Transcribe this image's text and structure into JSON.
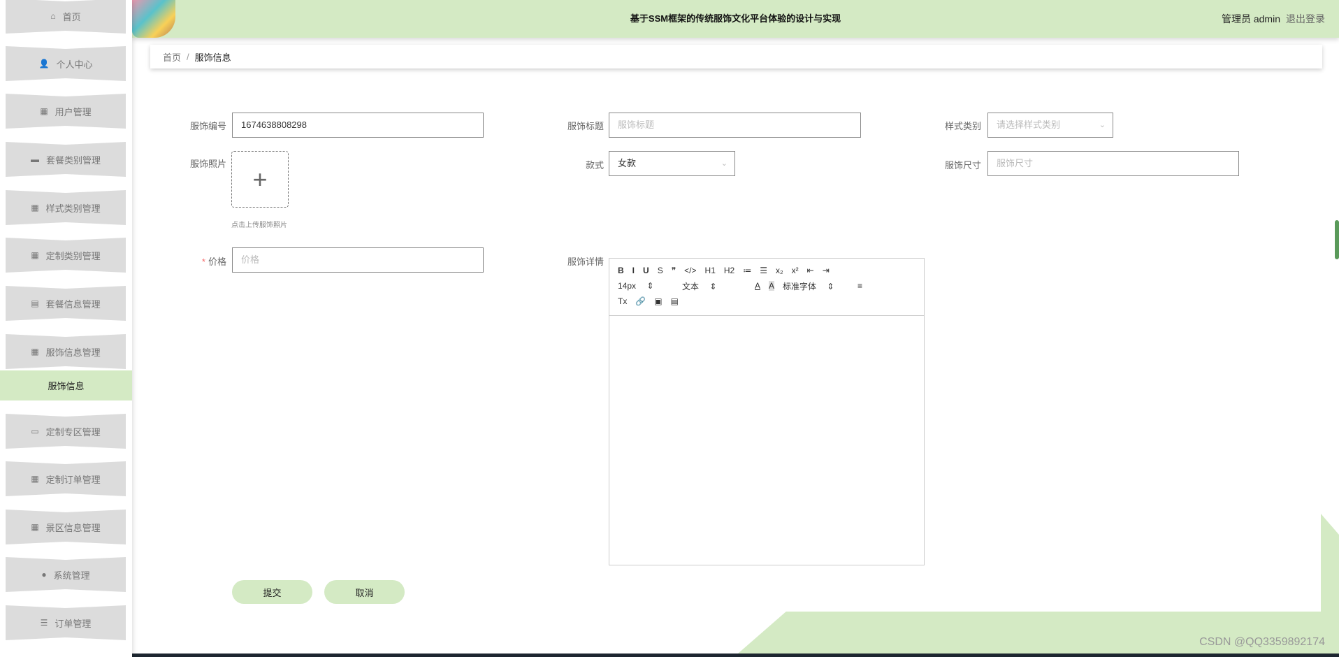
{
  "header": {
    "title": "基于SSM框架的传统服饰文化平台体验的设计与实现",
    "role": "管理员 admin",
    "logout": "退出登录"
  },
  "sidebar": {
    "items": [
      {
        "label": "首页",
        "icon": "home-icon",
        "glyph": "⌂"
      },
      {
        "label": "个人中心",
        "icon": "user-icon",
        "glyph": "👤"
      },
      {
        "label": "用户管理",
        "icon": "grid-icon",
        "glyph": "▦"
      },
      {
        "label": "套餐类别管理",
        "icon": "briefcase-icon",
        "glyph": "▬"
      },
      {
        "label": "样式类别管理",
        "icon": "grid-icon",
        "glyph": "▦"
      },
      {
        "label": "定制类别管理",
        "icon": "grid-icon",
        "glyph": "▦"
      },
      {
        "label": "套餐信息管理",
        "icon": "clipboard-icon",
        "glyph": "▤"
      },
      {
        "label": "服饰信息管理",
        "icon": "grid-icon",
        "glyph": "▦"
      },
      {
        "label": "定制专区管理",
        "icon": "monitor-icon",
        "glyph": "▭"
      },
      {
        "label": "定制订单管理",
        "icon": "grid-icon",
        "glyph": "▦"
      },
      {
        "label": "景区信息管理",
        "icon": "grid-icon",
        "glyph": "▦"
      },
      {
        "label": "系统管理",
        "icon": "location-icon",
        "glyph": "●"
      },
      {
        "label": "订单管理",
        "icon": "list-icon",
        "glyph": "☰"
      }
    ],
    "active_sub": "服饰信息"
  },
  "breadcrumb": {
    "home": "首页",
    "sep": "/",
    "current": "服饰信息"
  },
  "form": {
    "code_label": "服饰编号",
    "code_value": "1674638808298",
    "title_label": "服饰标题",
    "title_placeholder": "服饰标题",
    "style_label": "样式类别",
    "style_placeholder": "请选择样式类别",
    "photo_label": "服饰照片",
    "photo_hint": "点击上传服饰照片",
    "type_label": "款式",
    "type_value": "女款",
    "size_label": "服饰尺寸",
    "size_placeholder": "服饰尺寸",
    "price_label": "价格",
    "price_placeholder": "价格",
    "detail_label": "服饰详情"
  },
  "editor": {
    "row1": [
      "B",
      "I",
      "U",
      "S",
      "❞",
      "</>",
      "H1",
      "H2",
      "≔",
      "☰",
      "x₂",
      "x²",
      "⇤",
      "⇥"
    ],
    "font_size": "14px",
    "header": "文本",
    "font_color": "A",
    "bg_color": "A",
    "font_family": "标准字体",
    "align": "≡",
    "row3": [
      "Tx",
      "🔗",
      "▣",
      "▤"
    ]
  },
  "buttons": {
    "submit": "提交",
    "cancel": "取消"
  },
  "watermark": "CSDN @QQ3359892174",
  "colors": {
    "accent": "#d4eac4",
    "required": "#f56c6c"
  }
}
